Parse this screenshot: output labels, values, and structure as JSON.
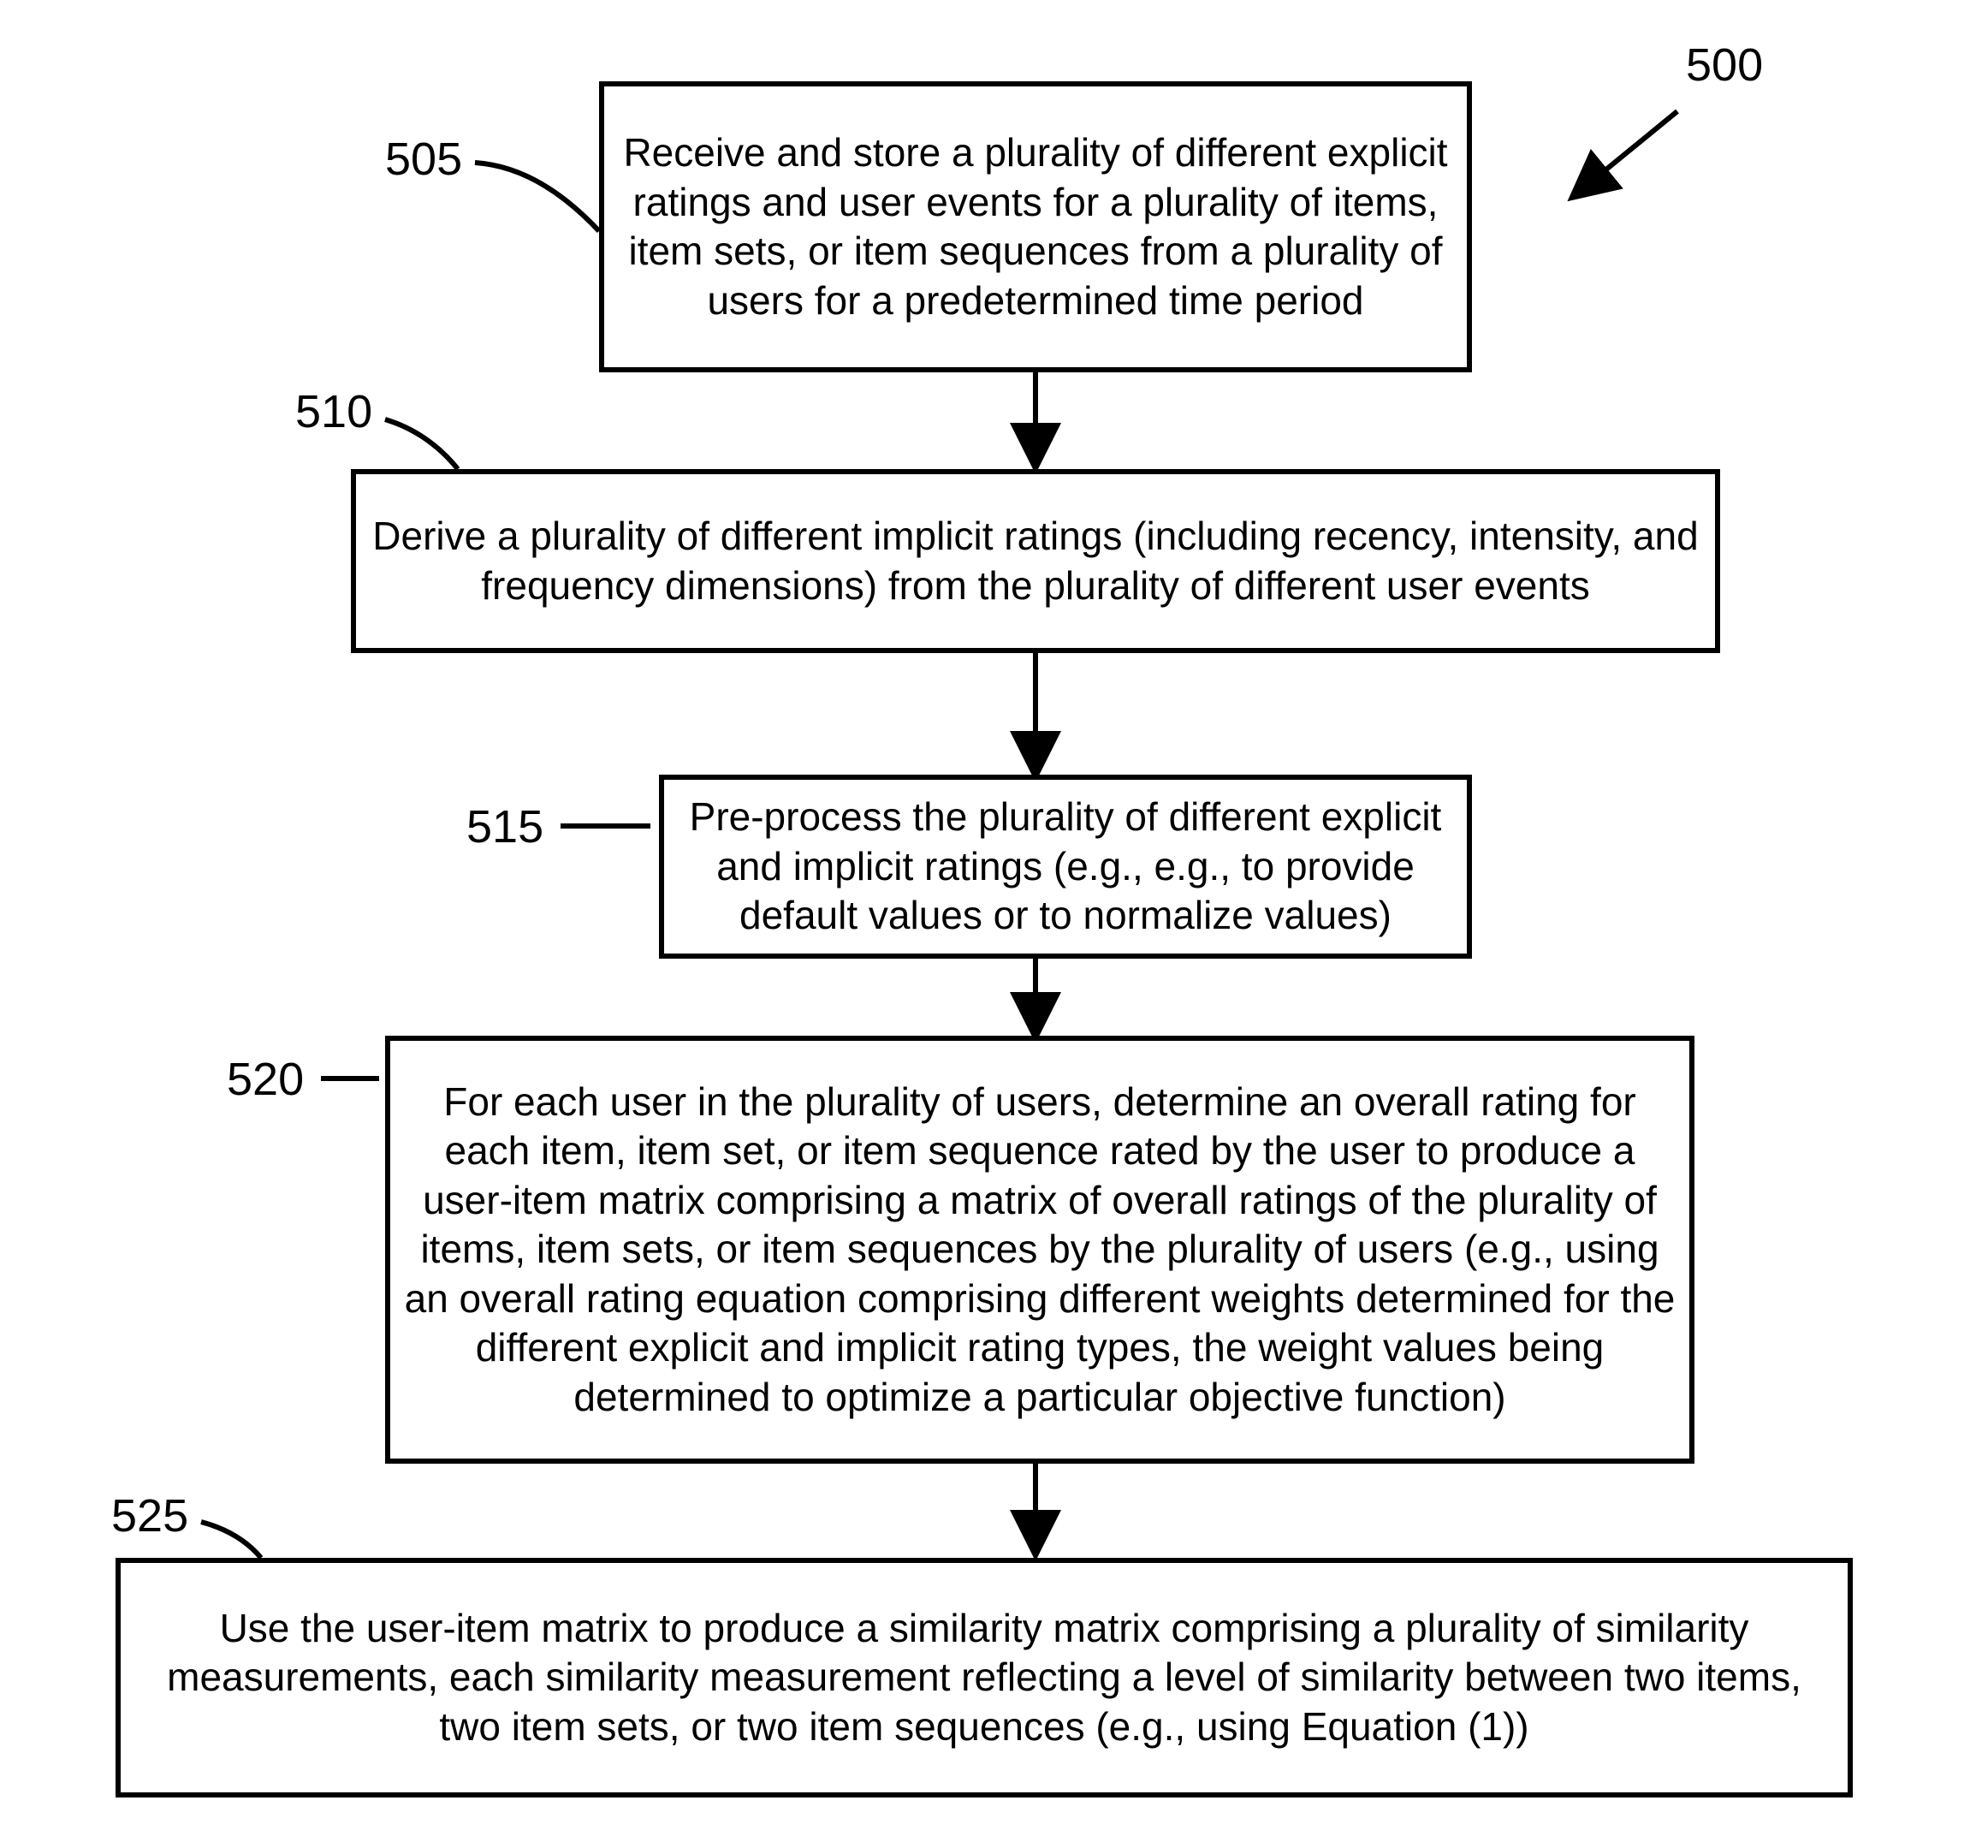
{
  "flow_label": "500",
  "steps": [
    {
      "num": "505",
      "text": "Receive and store a plurality of different explicit ratings and user events for a plurality of items, item sets, or item sequences from a plurality of users for a predetermined time period"
    },
    {
      "num": "510",
      "text": "Derive a plurality of different implicit ratings (including recency, intensity, and frequency dimensions) from the plurality of different user events"
    },
    {
      "num": "515",
      "text": "Pre-process the plurality of different explicit and implicit ratings (e.g., e.g., to provide default values or to normalize values)"
    },
    {
      "num": "520",
      "text": "For each user in the plurality of users, determine an overall rating for each item, item set, or item sequence rated by the user to produce a user-item matrix comprising a matrix of overall ratings of the plurality of items, item sets, or item sequences by the plurality of users (e.g., using an overall rating equation comprising different weights determined for the different explicit and implicit rating types, the weight values being determined to optimize a particular objective function)"
    },
    {
      "num": "525",
      "text": "Use the user-item matrix to produce a similarity matrix comprising a plurality of similarity measurements, each similarity measurement reflecting a level of similarity between two items, two item sets, or two item sequences (e.g., using Equation (1))"
    }
  ]
}
